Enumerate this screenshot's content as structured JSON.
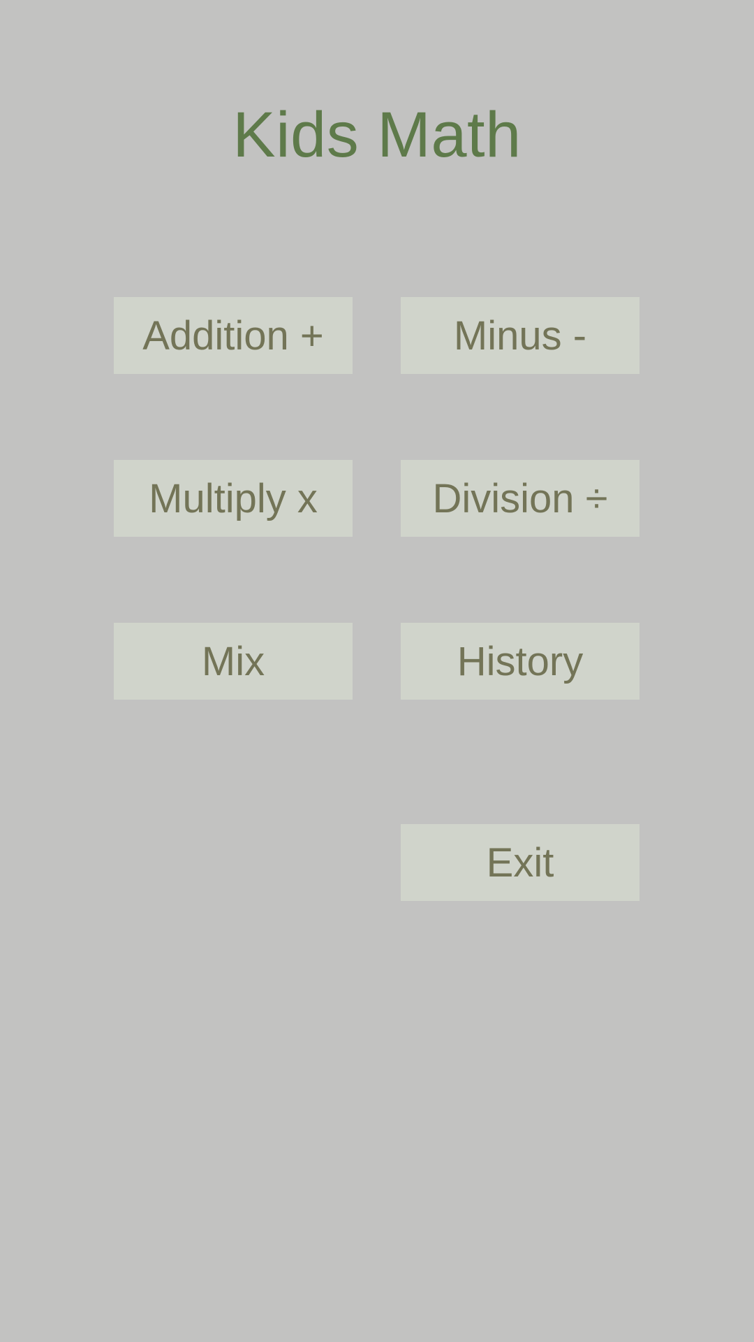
{
  "app": {
    "title": "Kids Math"
  },
  "menu": {
    "addition_label": "Addition +",
    "minus_label": "Minus -",
    "multiply_label": "Multiply x",
    "division_label": "Division ÷",
    "mix_label": "Mix",
    "history_label": "History",
    "exit_label": "Exit"
  },
  "colors": {
    "background": "#c2c2c1",
    "title": "#5e7a4a",
    "button_background": "#d0d4cb",
    "button_text": "#737457"
  }
}
